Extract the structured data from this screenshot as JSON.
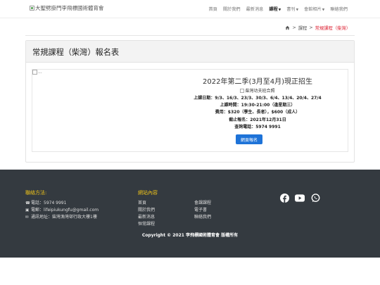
{
  "header": {
    "brand": "大聖劈掛門李飛標國術體育會",
    "nav": [
      {
        "label": "首頁",
        "dropdown": false,
        "active": false
      },
      {
        "label": "關於我們",
        "dropdown": false,
        "active": false
      },
      {
        "label": "最新消息",
        "dropdown": false,
        "active": false
      },
      {
        "label": "課程",
        "dropdown": true,
        "active": true
      },
      {
        "label": "書刊",
        "dropdown": true,
        "active": false
      },
      {
        "label": "會館相片",
        "dropdown": true,
        "active": false
      },
      {
        "label": "聯絡我們",
        "dropdown": false,
        "active": false
      }
    ]
  },
  "breadcrumb": {
    "items": [
      "課程"
    ],
    "current": "常規課程（柴灣）",
    "separator": ">"
  },
  "card": {
    "title": "常規課程（柴灣）報名表",
    "image_alt": "...",
    "season": "2022年第二季(3月至4月)現正招生",
    "photo_alt": "柴灣功夫班合照",
    "dates": "上課日期：9/3、16/3、23/3、30/3、6/4、13/4、20/4、27/4",
    "time": "上課時間：19:30-21:00（逢星期三）",
    "fee": "費用：$320（學生、長者），$600（成人）",
    "deadline": "截止報名：2021年12月31日",
    "phone": "查詢電話：5974 9991",
    "button": "網頁報名"
  },
  "footer": {
    "contact_heading": "聯絡方法:",
    "phone": "電話：5974 9991",
    "email": "電郵：lifeipiukungfu@gmail.com",
    "address": "通訊地址：柴灣漁灣邨行政大樓1樓",
    "site_heading": "網站內容",
    "links": [
      "首頁",
      "會課課程",
      "關於我們",
      "電子書",
      "最新消息",
      "聯絡我們",
      "恒常課程"
    ],
    "copyright": "Copyright © 2021 李飛標國術體育會 版權所有"
  },
  "colors": {
    "accent": "#1e73d8",
    "footer_bg": "#343a40",
    "footer_heading": "#f0c419",
    "breadcrumb_current": "#d23"
  },
  "icons": [
    "home-icon",
    "phone-icon",
    "email-icon",
    "envelope-icon",
    "facebook-icon",
    "youtube-icon",
    "whatsapp-icon"
  ]
}
